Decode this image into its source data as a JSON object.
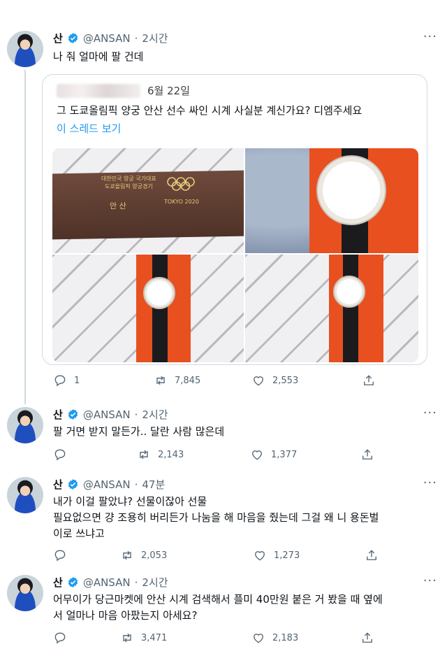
{
  "tweets": [
    {
      "name": "산",
      "handle": "@ANSAN",
      "dot": "·",
      "time": "2시간",
      "text": [
        "나 줘 얼마에 팔 건데"
      ],
      "quote": {
        "date": "6월 22일",
        "text": "그 도쿄올림픽 양궁 안산 선수 싸인 시계 사실분 계신가요? 디엠주세요",
        "link": "이 스레드 보기",
        "box_text": [
          "대한민국 양궁 국가대표",
          "도쿄올림픽 양궁경기",
          "안 산",
          "TOKYO 2020"
        ]
      },
      "replies": "1",
      "retweets": "7,845",
      "likes": "2,553"
    },
    {
      "name": "산",
      "handle": "@ANSAN",
      "dot": "·",
      "time": "2시간",
      "text": [
        "팔 거면 받지 말든가.. 달란 사람 많은데"
      ],
      "replies": "",
      "retweets": "2,143",
      "likes": "1,377"
    },
    {
      "name": "산",
      "handle": "@ANSAN",
      "dot": "·",
      "time": "47분",
      "text": [
        "내가 이걸 팔았냐? 선물이잖아 선물",
        "필요없으면 걍 조용히 버리든가 나눔을 해 마음을 줬는데 그걸 왜 니 용돈벌",
        "이로 쓰냐고"
      ],
      "replies": "",
      "retweets": "2,053",
      "likes": "1,273"
    },
    {
      "name": "산",
      "handle": "@ANSAN",
      "dot": "·",
      "time": "2시간",
      "text": [
        "어무이가 당근마켓에 안산 시계 검색해서 플미 40만원 붙은 거 봤을 때 옆에",
        "서 얼마나 마음 아팠는지 아세요?"
      ],
      "replies": "",
      "retweets": "3,471",
      "likes": "2,183"
    }
  ],
  "more_icon": "···",
  "colors": {
    "link": "#1d9bf0",
    "verified": "#1d9bf0",
    "muted": "#536471",
    "border": "#cfd9de"
  }
}
